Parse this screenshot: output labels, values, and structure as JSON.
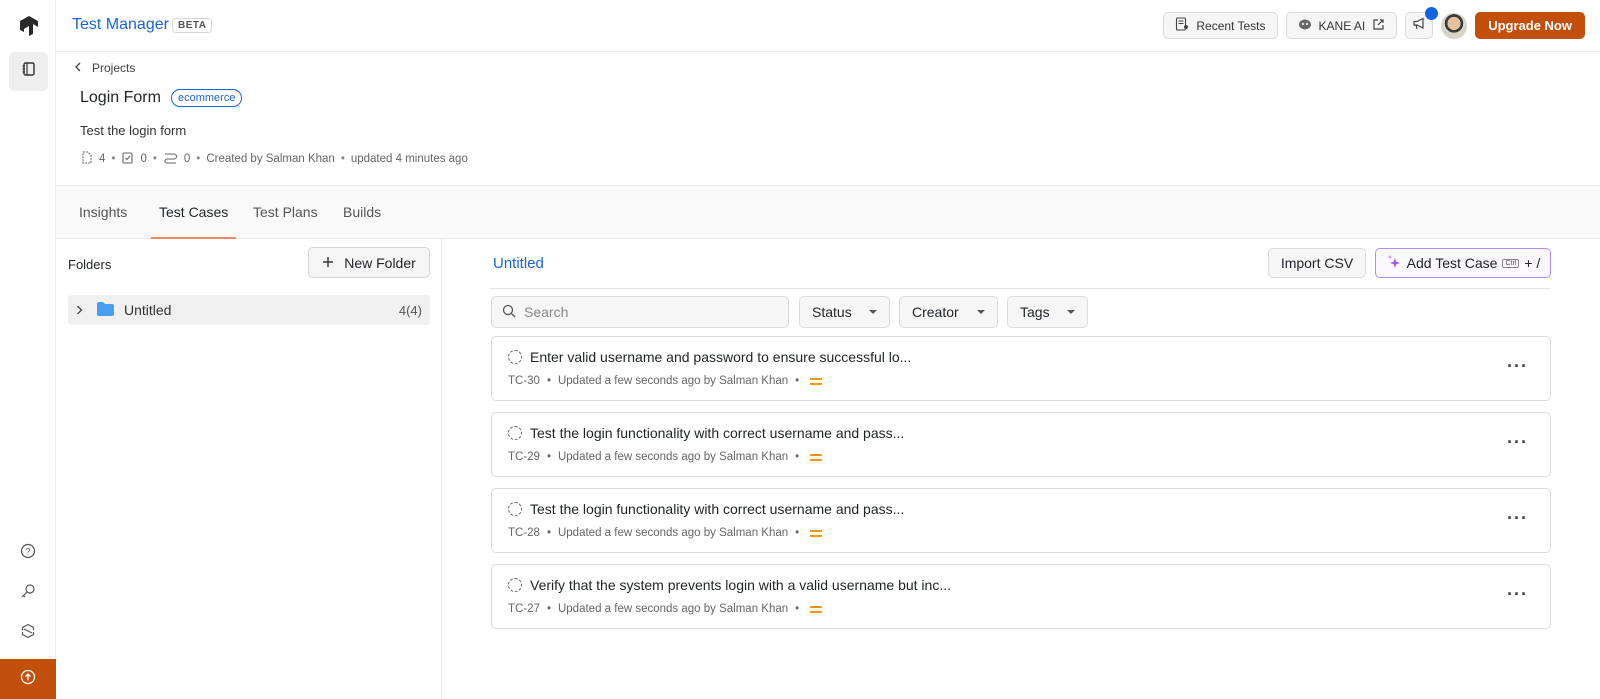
{
  "app": {
    "title": "Test Manager",
    "badge": "BETA"
  },
  "topbar": {
    "recent_tests": "Recent Tests",
    "kane_ai": "KANE AI",
    "upgrade": "Upgrade Now"
  },
  "project": {
    "breadcrumb": "Projects",
    "title": "Login Form",
    "tag": "ecommerce",
    "description": "Test the login form",
    "test_case_count": "4",
    "test_plan_count": "0",
    "build_count": "0",
    "created_by": "Created by Salman Khan",
    "updated": "updated 4 minutes ago"
  },
  "tabs": [
    {
      "label": "Insights"
    },
    {
      "label": "Test Cases",
      "active": true
    },
    {
      "label": "Test Plans"
    },
    {
      "label": "Builds"
    }
  ],
  "folders": {
    "label": "Folders",
    "new_folder": "New Folder",
    "items": [
      {
        "name": "Untitled",
        "count": "4(4)"
      }
    ]
  },
  "main": {
    "folder_title": "Untitled",
    "import_csv": "Import CSV",
    "add_test_case": "Add Test Case",
    "shortcut_key": "Ctrl",
    "shortcut_rest": "+ /",
    "search_placeholder": "Search",
    "filters": [
      "Status",
      "Creator",
      "Tags"
    ],
    "cases": [
      {
        "title": "Enter valid username and password to ensure successful lo...",
        "id": "TC-30",
        "updated": "Updated a few seconds ago by Salman Khan",
        "priority": "medium"
      },
      {
        "title": "Test the login functionality with correct username and pass...",
        "id": "TC-29",
        "updated": "Updated a few seconds ago by Salman Khan",
        "priority": "medium"
      },
      {
        "title": "Test the login functionality with correct username and pass...",
        "id": "TC-28",
        "updated": "Updated a few seconds ago by Salman Khan",
        "priority": "medium"
      },
      {
        "title": "Verify that the system prevents login with a valid username but inc...",
        "id": "TC-27",
        "updated": "Updated a few seconds ago by Salman Khan",
        "priority": "medium"
      }
    ]
  },
  "colors": {
    "brand": "#1b64d6",
    "accent": "#c2500c",
    "priority_medium": "#f29a12",
    "tab_underline": "#f08a6c"
  }
}
